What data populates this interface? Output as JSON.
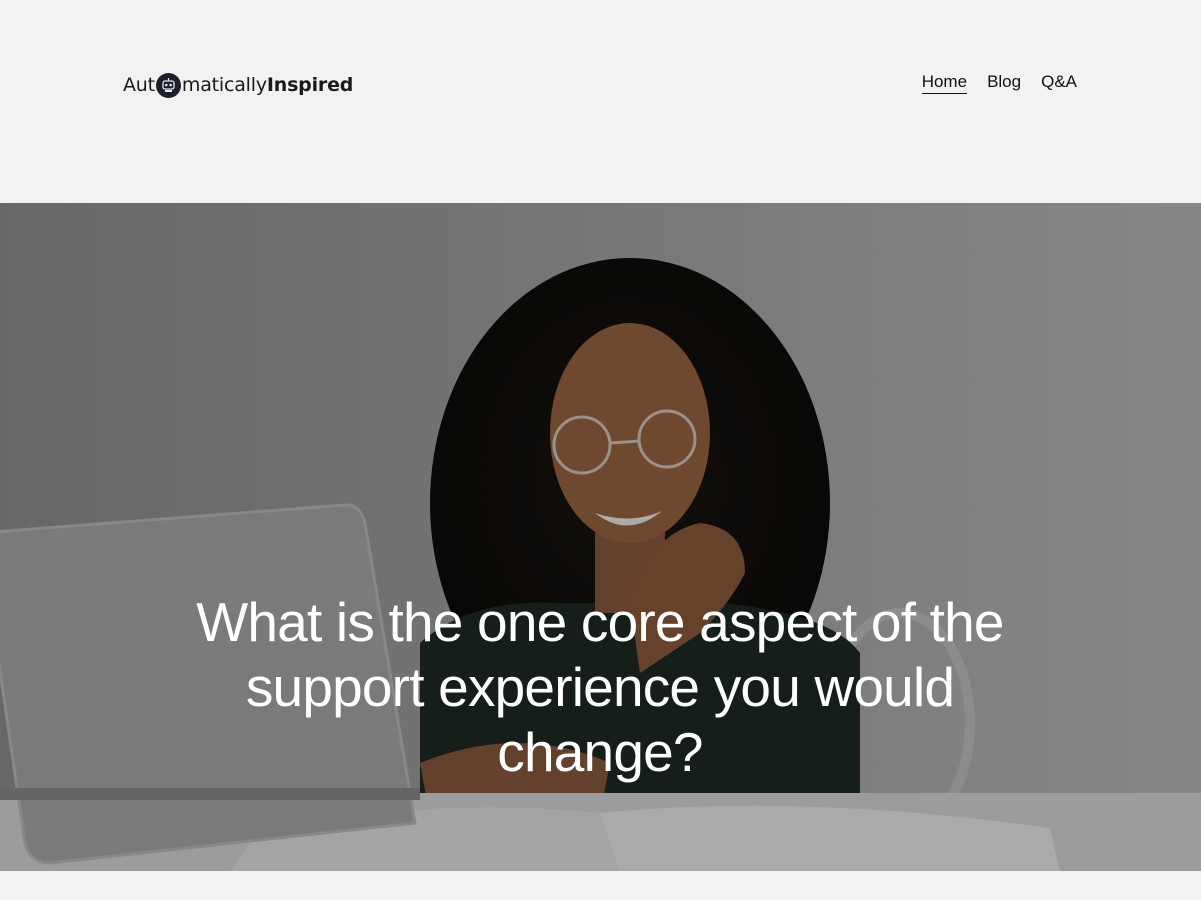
{
  "site": {
    "logo_prefix": "Aut",
    "logo_middle": "matically",
    "logo_bold": "Inspired"
  },
  "nav": {
    "items": [
      {
        "label": "Home",
        "active": true
      },
      {
        "label": "Blog",
        "active": false
      },
      {
        "label": "Q&A",
        "active": false
      }
    ]
  },
  "hero": {
    "title": "What is the one core aspect of the support experience you would change?"
  },
  "colors": {
    "background": "#f3f2f0",
    "text": "#111111",
    "hero_text": "#ffffff",
    "logo_badge": "#1d1f2a"
  }
}
